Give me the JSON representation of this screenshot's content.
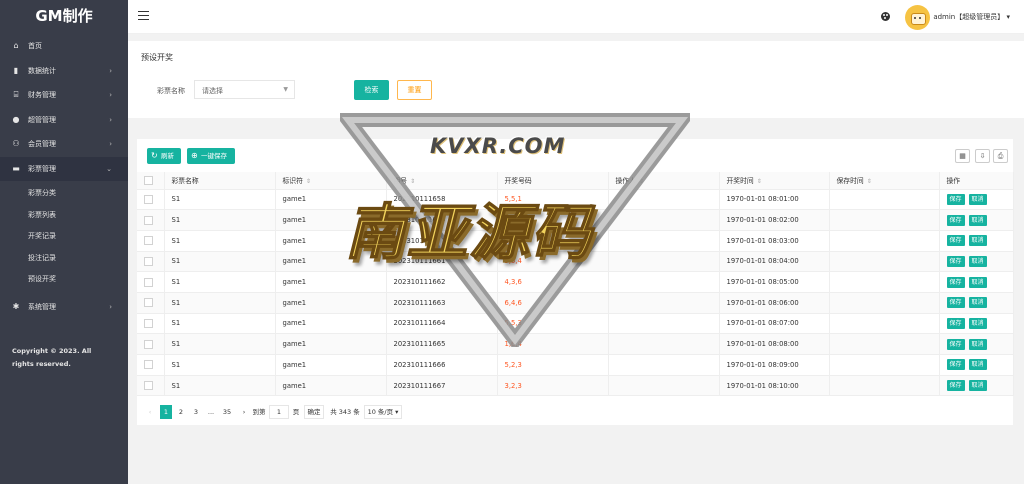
{
  "app": {
    "logo": "GM制作"
  },
  "sidebar": {
    "items": [
      {
        "label": "首页",
        "icon": "home-icon",
        "glyph": "⌂",
        "has_arrow": false
      },
      {
        "label": "数据统计",
        "icon": "bar-chart-icon",
        "glyph": "▮",
        "has_arrow": true
      },
      {
        "label": "财务管理",
        "icon": "bank-icon",
        "glyph": "⌸",
        "has_arrow": true
      },
      {
        "label": "超管管理",
        "icon": "user-icon",
        "glyph": "●",
        "has_arrow": true
      },
      {
        "label": "会员管理",
        "icon": "users-icon",
        "glyph": "⚇",
        "has_arrow": true
      },
      {
        "label": "彩票管理",
        "icon": "gamepad-icon",
        "glyph": "▬",
        "has_arrow": true,
        "expanded": true
      }
    ],
    "sub_items": [
      "彩票分类",
      "彩票列表",
      "开奖记录",
      "投注记录",
      "预设开奖"
    ],
    "after_items": [
      {
        "label": "系统管理",
        "icon": "gear-icon",
        "glyph": "✱",
        "has_arrow": true
      }
    ],
    "copyright": "Copyright © 2023. All rights reserved."
  },
  "header": {
    "user": "admin【超级管理员】",
    "user_caret": "▾"
  },
  "search": {
    "title": "预设开奖",
    "label": "彩票名称",
    "placeholder": "请选择",
    "search_label": "检索",
    "reset_label": "重置"
  },
  "toolbar": {
    "refresh_label": "刷新",
    "save_all_label": "一键保存"
  },
  "table": {
    "columns": [
      "彩票名称",
      "标识符",
      "期号",
      "开奖号码",
      "操作人",
      "开奖时间",
      "保存时间",
      "操作"
    ],
    "rows": [
      {
        "name": "S1",
        "code": "game1",
        "issue": "202310111658",
        "numbers": "5,5,1",
        "operator": "",
        "open_time": "1970-01-01 08:01:00",
        "save_time": ""
      },
      {
        "name": "S1",
        "code": "game1",
        "issue": "202310111659",
        "numbers": "5,7,6",
        "operator": "",
        "open_time": "1970-01-01 08:02:00",
        "save_time": ""
      },
      {
        "name": "S1",
        "code": "game1",
        "issue": "202310111660",
        "numbers": "2,5,5",
        "operator": "",
        "open_time": "1970-01-01 08:03:00",
        "save_time": ""
      },
      {
        "name": "S1",
        "code": "game1",
        "issue": "202310111661",
        "numbers": "5,5,4",
        "operator": "",
        "open_time": "1970-01-01 08:04:00",
        "save_time": ""
      },
      {
        "name": "S1",
        "code": "game1",
        "issue": "202310111662",
        "numbers": "4,3,6",
        "operator": "",
        "open_time": "1970-01-01 08:05:00",
        "save_time": ""
      },
      {
        "name": "S1",
        "code": "game1",
        "issue": "202310111663",
        "numbers": "6,4,6",
        "operator": "",
        "open_time": "1970-01-01 08:06:00",
        "save_time": ""
      },
      {
        "name": "S1",
        "code": "game1",
        "issue": "202310111664",
        "numbers": "5,5,3",
        "operator": "",
        "open_time": "1970-01-01 08:07:00",
        "save_time": ""
      },
      {
        "name": "S1",
        "code": "game1",
        "issue": "202310111665",
        "numbers": "1,6,4",
        "operator": "",
        "open_time": "1970-01-01 08:08:00",
        "save_time": ""
      },
      {
        "name": "S1",
        "code": "game1",
        "issue": "202310111666",
        "numbers": "5,2,3",
        "operator": "",
        "open_time": "1970-01-01 08:09:00",
        "save_time": ""
      },
      {
        "name": "S1",
        "code": "game1",
        "issue": "202310111667",
        "numbers": "3,2,3",
        "operator": "",
        "open_time": "1970-01-01 08:10:00",
        "save_time": ""
      }
    ],
    "save_btn": "保存",
    "cancel_btn": "取消"
  },
  "pager": {
    "pages": [
      "1",
      "2",
      "3",
      "...",
      "35"
    ],
    "current": "1",
    "goto_label": "到第",
    "goto_value": "1",
    "page_unit": "页",
    "confirm_label": "确定",
    "total": "共 343 条",
    "per_page": "10 条/页"
  },
  "watermark": {
    "top": "KVXR.COM",
    "main": "南亚源码"
  },
  "colors": {
    "accent": "#16b3a0",
    "sidebar": "#393d49",
    "number": "#ff5722",
    "reset": "#ff9800"
  }
}
